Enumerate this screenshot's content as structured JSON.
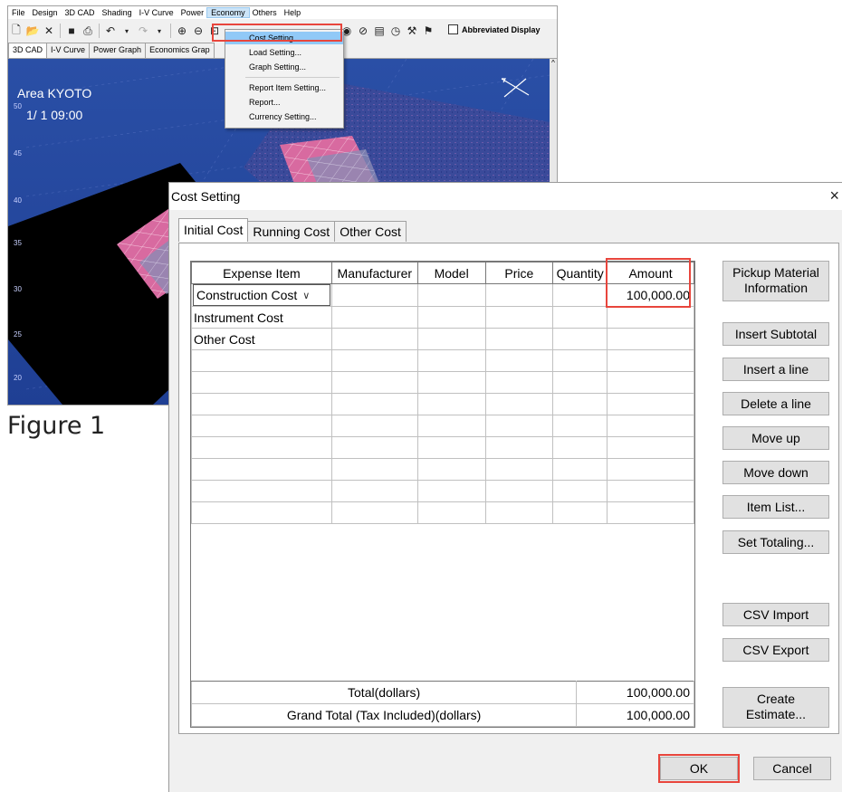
{
  "app": {
    "menu": [
      "File",
      "Design",
      "3D CAD",
      "Shading",
      "I-V Curve",
      "Power",
      "Economy",
      "Others",
      "Help"
    ],
    "abbreviated_display": "Abbreviated Display",
    "tabs": [
      "3D CAD",
      "I-V Curve",
      "Power Graph",
      "Economics Grap"
    ],
    "view": {
      "area": "Area KYOTO",
      "datetime": "1/ 1 09:00",
      "y_ticks": [
        "50",
        "45",
        "40",
        "35",
        "30",
        "25",
        "20"
      ]
    },
    "economy_menu": [
      "Cost Setting...",
      "Load Setting...",
      "Graph Setting...",
      "Report Item Setting...",
      "Report...",
      "Currency Setting..."
    ]
  },
  "figure_caption": "Figure 1",
  "dialog": {
    "title": "Cost Setting",
    "close": "×",
    "tabs": [
      "Initial Cost",
      "Running Cost",
      "Other Cost"
    ],
    "columns": [
      "Expense Item",
      "Manufacturer",
      "Model",
      "Price",
      "Quantity",
      "Amount"
    ],
    "rows": [
      {
        "item": "Construction Cost",
        "amount": "100,000.00"
      },
      {
        "item": "Instrument Cost",
        "amount": ""
      },
      {
        "item": "Other Cost",
        "amount": ""
      }
    ],
    "totals": [
      {
        "label": "Total(dollars)",
        "value": "100,000.00"
      },
      {
        "label": "Grand Total (Tax Included)(dollars)",
        "value": "100,000.00"
      }
    ],
    "buttons": {
      "pickup_line1": "Pickup Material",
      "pickup_line2": "Information",
      "insert_subtotal": "Insert Subtotal",
      "insert_line": "Insert a line",
      "delete_line": "Delete a line",
      "move_up": "Move up",
      "move_down": "Move down",
      "item_list": "Item List...",
      "set_totaling": "Set Totaling...",
      "csv_import": "CSV Import",
      "csv_export": "CSV Export",
      "create_line1": "Create",
      "create_line2": "Estimate...",
      "ok": "OK",
      "cancel": "Cancel"
    }
  },
  "colors": {
    "highlight": "#e8453c",
    "view_bg": "#2a4fa6",
    "menu_highlight": "#91c9f7"
  }
}
